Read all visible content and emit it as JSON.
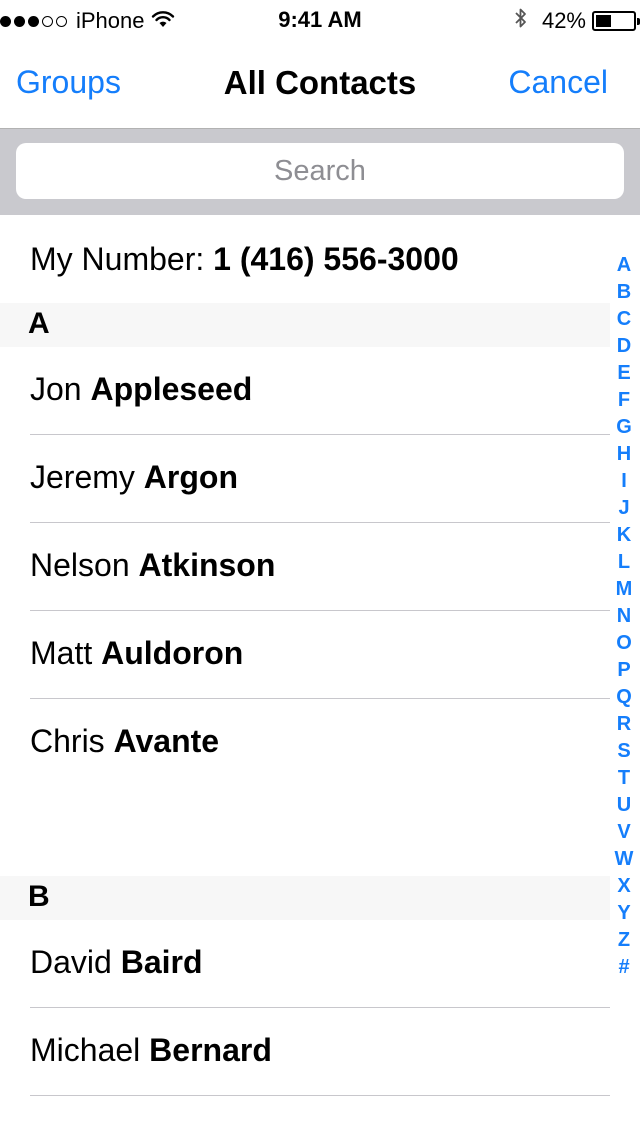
{
  "status_bar": {
    "carrier": "iPhone",
    "time": "9:41 AM",
    "battery_percent_label": "42%",
    "battery_level": 0.42,
    "signal_bars_filled": 3,
    "signal_bars_total": 5,
    "icons": [
      "wifi-icon",
      "bluetooth-icon",
      "battery-icon"
    ]
  },
  "nav": {
    "left_button": "Groups",
    "title": "All Contacts",
    "right_button": "Cancel"
  },
  "search": {
    "placeholder": "Search",
    "value": ""
  },
  "my_number": {
    "label": "My Number:",
    "number": "1 (416) 556-3000"
  },
  "sections": [
    {
      "letter": "A",
      "contacts": [
        {
          "first": "Jon",
          "last": "Appleseed"
        },
        {
          "first": "Jeremy",
          "last": "Argon"
        },
        {
          "first": "Nelson",
          "last": "Atkinson"
        },
        {
          "first": "Matt",
          "last": "Auldoron"
        },
        {
          "first": "Chris",
          "last": "Avante"
        }
      ]
    },
    {
      "letter": "B",
      "contacts": [
        {
          "first": "David",
          "last": "Baird"
        },
        {
          "first": "Michael",
          "last": "Bernard"
        }
      ]
    }
  ],
  "index": [
    "A",
    "B",
    "C",
    "D",
    "E",
    "F",
    "G",
    "H",
    "I",
    "J",
    "K",
    "L",
    "M",
    "N",
    "O",
    "P",
    "Q",
    "R",
    "S",
    "T",
    "U",
    "V",
    "W",
    "X",
    "Y",
    "Z",
    "#"
  ],
  "colors": {
    "accent": "#157efb",
    "search_bar_bg": "#c9c9ce",
    "section_header_bg": "#f7f7f7",
    "separator": "#c8c7cc"
  }
}
